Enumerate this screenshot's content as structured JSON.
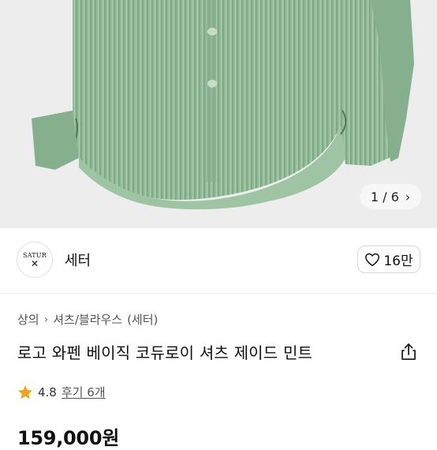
{
  "gallery": {
    "counter_current": "1",
    "counter_sep": "/",
    "counter_total": "6",
    "colors": {
      "background": "#ededed",
      "shirt": "#8fb896",
      "shirt_dark": "#6f9a77",
      "shirt_light": "#a6c9ab"
    }
  },
  "seller": {
    "logo_text": "SATUR",
    "name": "세터",
    "likes": "16만"
  },
  "breadcrumb": {
    "level1": "상의",
    "level2": "셔츠/블라우스",
    "brand": "(세터)"
  },
  "product": {
    "title": "로고 와펜 베이직 코듀로이 셔츠 제이드 민트",
    "rating": "4.8",
    "reviews_label": "후기 6개",
    "price": "159,000원"
  },
  "icons": {
    "chevron": "chevron-right-icon",
    "heart": "heart-outline-icon",
    "share": "share-icon",
    "star": "star-icon"
  },
  "colors": {
    "star": "#f2a51a",
    "divider": "#ececec"
  }
}
